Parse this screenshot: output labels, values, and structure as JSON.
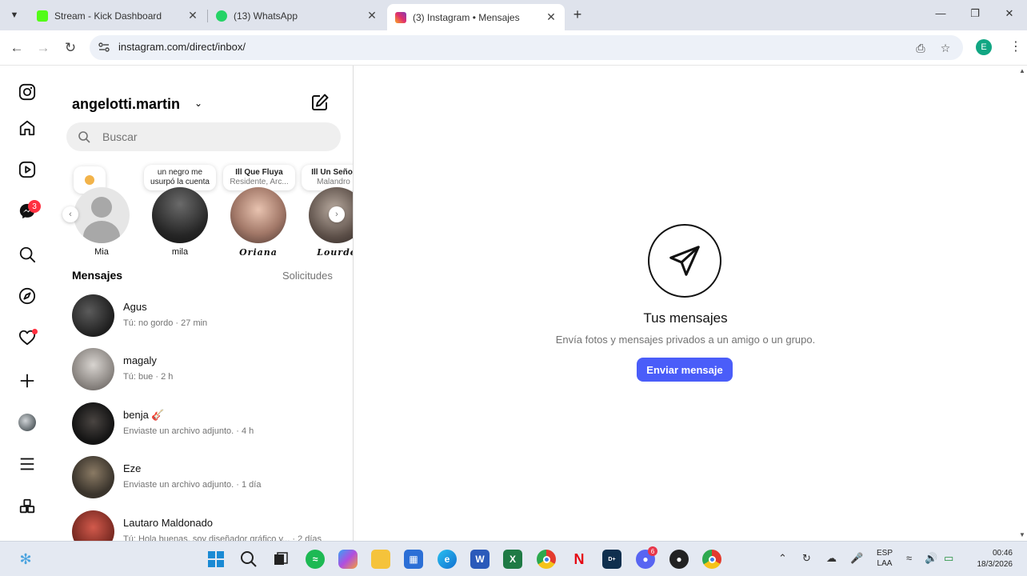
{
  "browser": {
    "tabs": [
      {
        "title": "Stream - Kick Dashboard",
        "favicon": "kick-icon",
        "color": "#53fc18",
        "active": false
      },
      {
        "title": "(13) WhatsApp",
        "favicon": "whatsapp-icon",
        "color": "#25d366",
        "badge": "13",
        "active": false
      },
      {
        "title": "(3) Instagram • Mensajes",
        "favicon": "instagram-icon",
        "color": "#e1306c",
        "active": true
      }
    ],
    "url": "instagram.com/direct/inbox/",
    "profile_initial": "E"
  },
  "instagram": {
    "nav": {
      "messages_badge": "3",
      "icons": [
        "instagram-icon",
        "home-icon",
        "reels-icon",
        "messenger-icon",
        "search-icon",
        "explore-icon",
        "heart-icon",
        "create-icon",
        "profile-avatar",
        "menu-icon",
        "more-apps-icon"
      ]
    },
    "username": "angelotti.martin",
    "search_placeholder": "Buscar",
    "notes": [
      {
        "text": "un negro me usurpó la cuenta"
      },
      {
        "title": "Ill Que Fluya",
        "sub": "Residente, Arc..."
      },
      {
        "title": "Ill Un Señor",
        "sub": "Malandro"
      }
    ],
    "stories": [
      {
        "name": "Mia"
      },
      {
        "name": "mila"
      },
      {
        "name": "𝑶𝒓𝒊𝒂𝒏𝒂"
      },
      {
        "name": "𝑳𝒐𝒖𝒓𝒅𝒆"
      }
    ],
    "messages_title": "Mensajes",
    "requests_label": "Solicitudes",
    "conversations": [
      {
        "name": "Agus",
        "preview": "Tú: no gordo · 27 min"
      },
      {
        "name": "magaly",
        "preview": "Tú: bue · 2 h"
      },
      {
        "name": "benja 🎸",
        "preview": "Enviaste un archivo adjunto. · 4 h"
      },
      {
        "name": "Eze",
        "preview": "Enviaste un archivo adjunto. · 1 día"
      },
      {
        "name": "Lautaro Maldonado",
        "preview": "Tú: Hola buenas, soy diseñador gráfico y... · 2 días"
      }
    ],
    "empty_state": {
      "title": "Tus mensajes",
      "subtitle": "Envía fotos y mensajes privados a un amigo o un grupo.",
      "button": "Enviar mensaje"
    }
  },
  "taskbar": {
    "apps": [
      "copilot-icon",
      "start-icon",
      "search-icon",
      "task-view-icon",
      "spotify-icon",
      "copilot-app-icon",
      "file-explorer-icon",
      "store-icon",
      "edge-icon",
      "word-icon",
      "excel-icon",
      "chrome-icon",
      "netflix-icon",
      "disney-icon",
      "discord-icon",
      "obs-icon",
      "chrome-profile-icon"
    ],
    "discord_badge": "6",
    "lang_top": "ESP",
    "lang_bottom": "LAA",
    "time": "00:46",
    "date": "18/3/2026"
  }
}
